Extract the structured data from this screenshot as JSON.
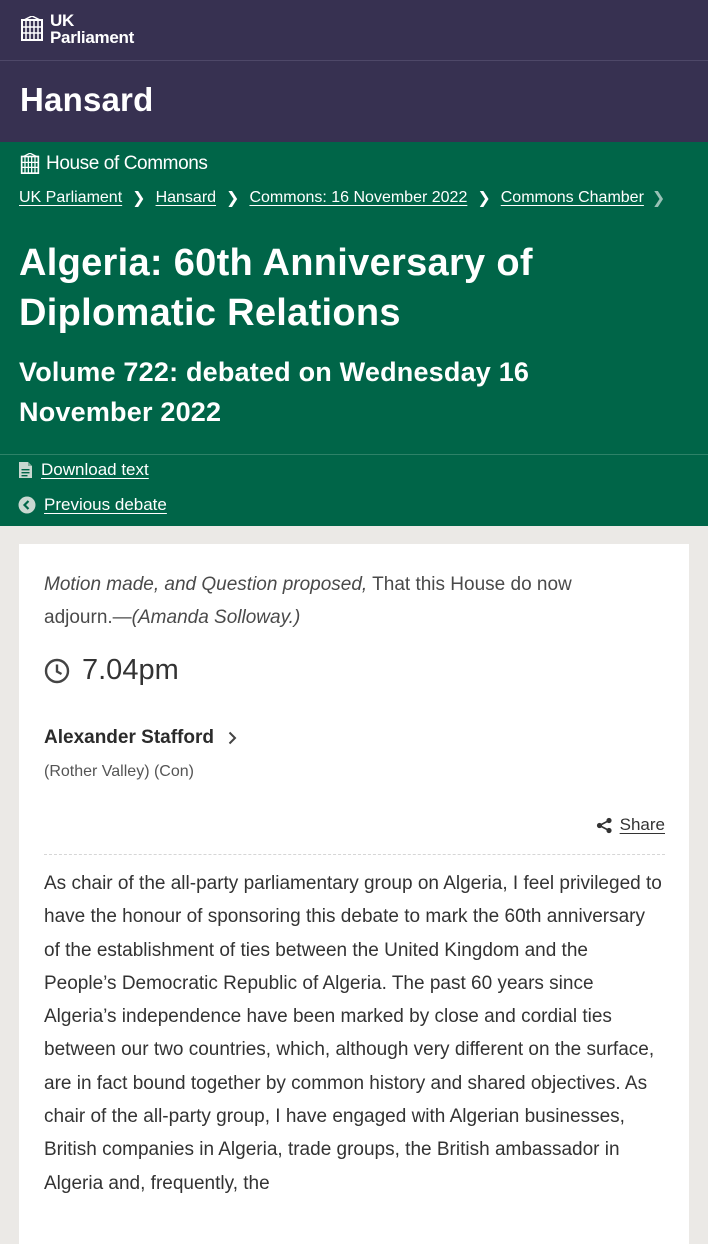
{
  "parliament": {
    "line1": "UK",
    "line2": "Parliament",
    "logo_icon": "portcullis-icon"
  },
  "hansard": {
    "title": "Hansard"
  },
  "house": {
    "label": "House of Commons",
    "icon": "portcullis-icon"
  },
  "breadcrumb": [
    "UK Parliament",
    "Hansard",
    "Commons: 16 November 2022",
    "Commons Chamber"
  ],
  "debate": {
    "title": "Algeria: 60th Anniversary of Diplomatic Relations",
    "volume": "Volume 722: debated on Wednesday 16 November 2022"
  },
  "tools": {
    "download": "Download text",
    "previous": "Previous debate"
  },
  "content": {
    "motion_italic": "Motion made, and Question proposed,",
    "motion_text": " That this House do now adjourn.—",
    "motion_mover": "(Amanda Solloway.)",
    "time": "7.04pm",
    "member": "Alexander Stafford",
    "constituency": "(Rother Valley) (Con)",
    "share": "Share",
    "speech": "As chair of the all-party parliamentary group on Algeria, I feel privileged to have the honour of sponsoring this debate to mark the 60th anniversary of the establishment of ties between the United Kingdom and the People’s Democratic Republic of Algeria. The past 60 years since Algeria’s independence have been marked by close and cordial ties between our two countries, which, although very different on the surface, are in fact bound together by common history and shared objectives. As chair of the all-party group, I have engaged with Algerian businesses, British companies in Algeria, trade groups, the British ambassador in Algeria and, frequently, the"
  },
  "colors": {
    "purple": "#373151",
    "green": "#006548",
    "background": "#ebe9e6"
  }
}
